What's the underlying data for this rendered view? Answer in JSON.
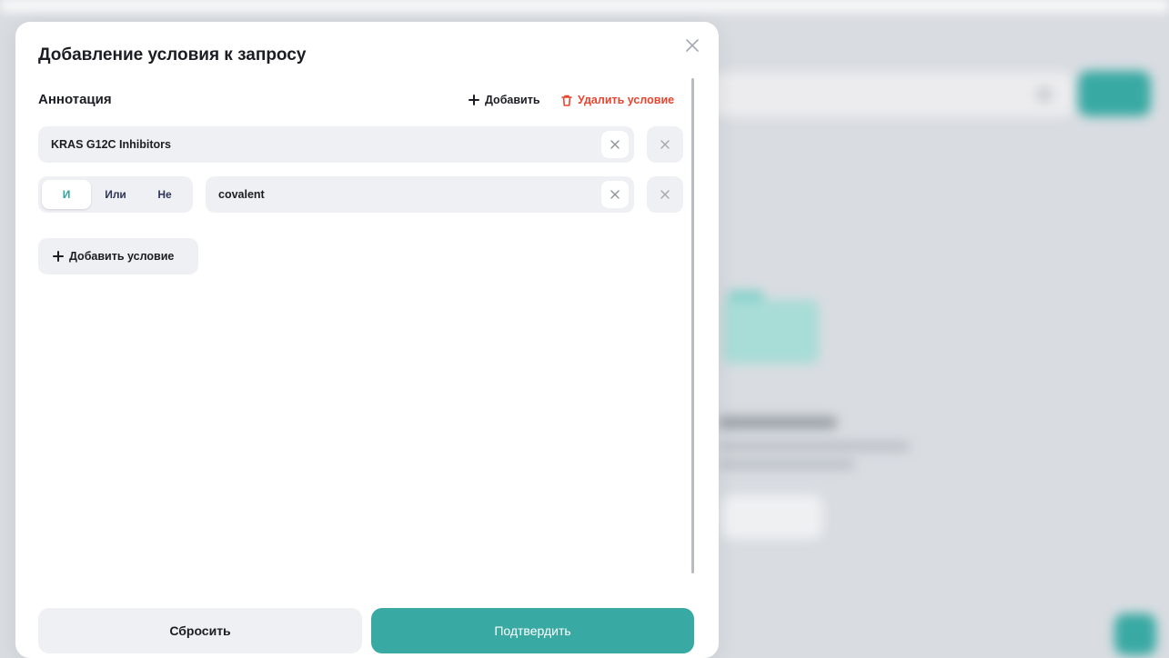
{
  "modal": {
    "title": "Добавление условия к запросу",
    "section_label": "Аннотация",
    "add_label": "Добавить",
    "delete_condition_label": "Удалить условие",
    "conditions": [
      {
        "value": "KRAS G12C Inhibitors"
      },
      {
        "value": "covalent",
        "logic_options": [
          "И",
          "Или",
          "Не"
        ],
        "selected_logic": "И"
      }
    ],
    "add_condition_label": "Добавить условие",
    "reset_label": "Сбросить",
    "confirm_label": "Подтвердить"
  },
  "colors": {
    "accent": "#39a9a3",
    "danger": "#e8452e",
    "field_bg": "#eef0f3",
    "text": "#1b1d22"
  },
  "icons": {
    "close": "close-icon",
    "plus": "plus-icon",
    "trash": "trash-icon",
    "clear": "clear-icon"
  }
}
